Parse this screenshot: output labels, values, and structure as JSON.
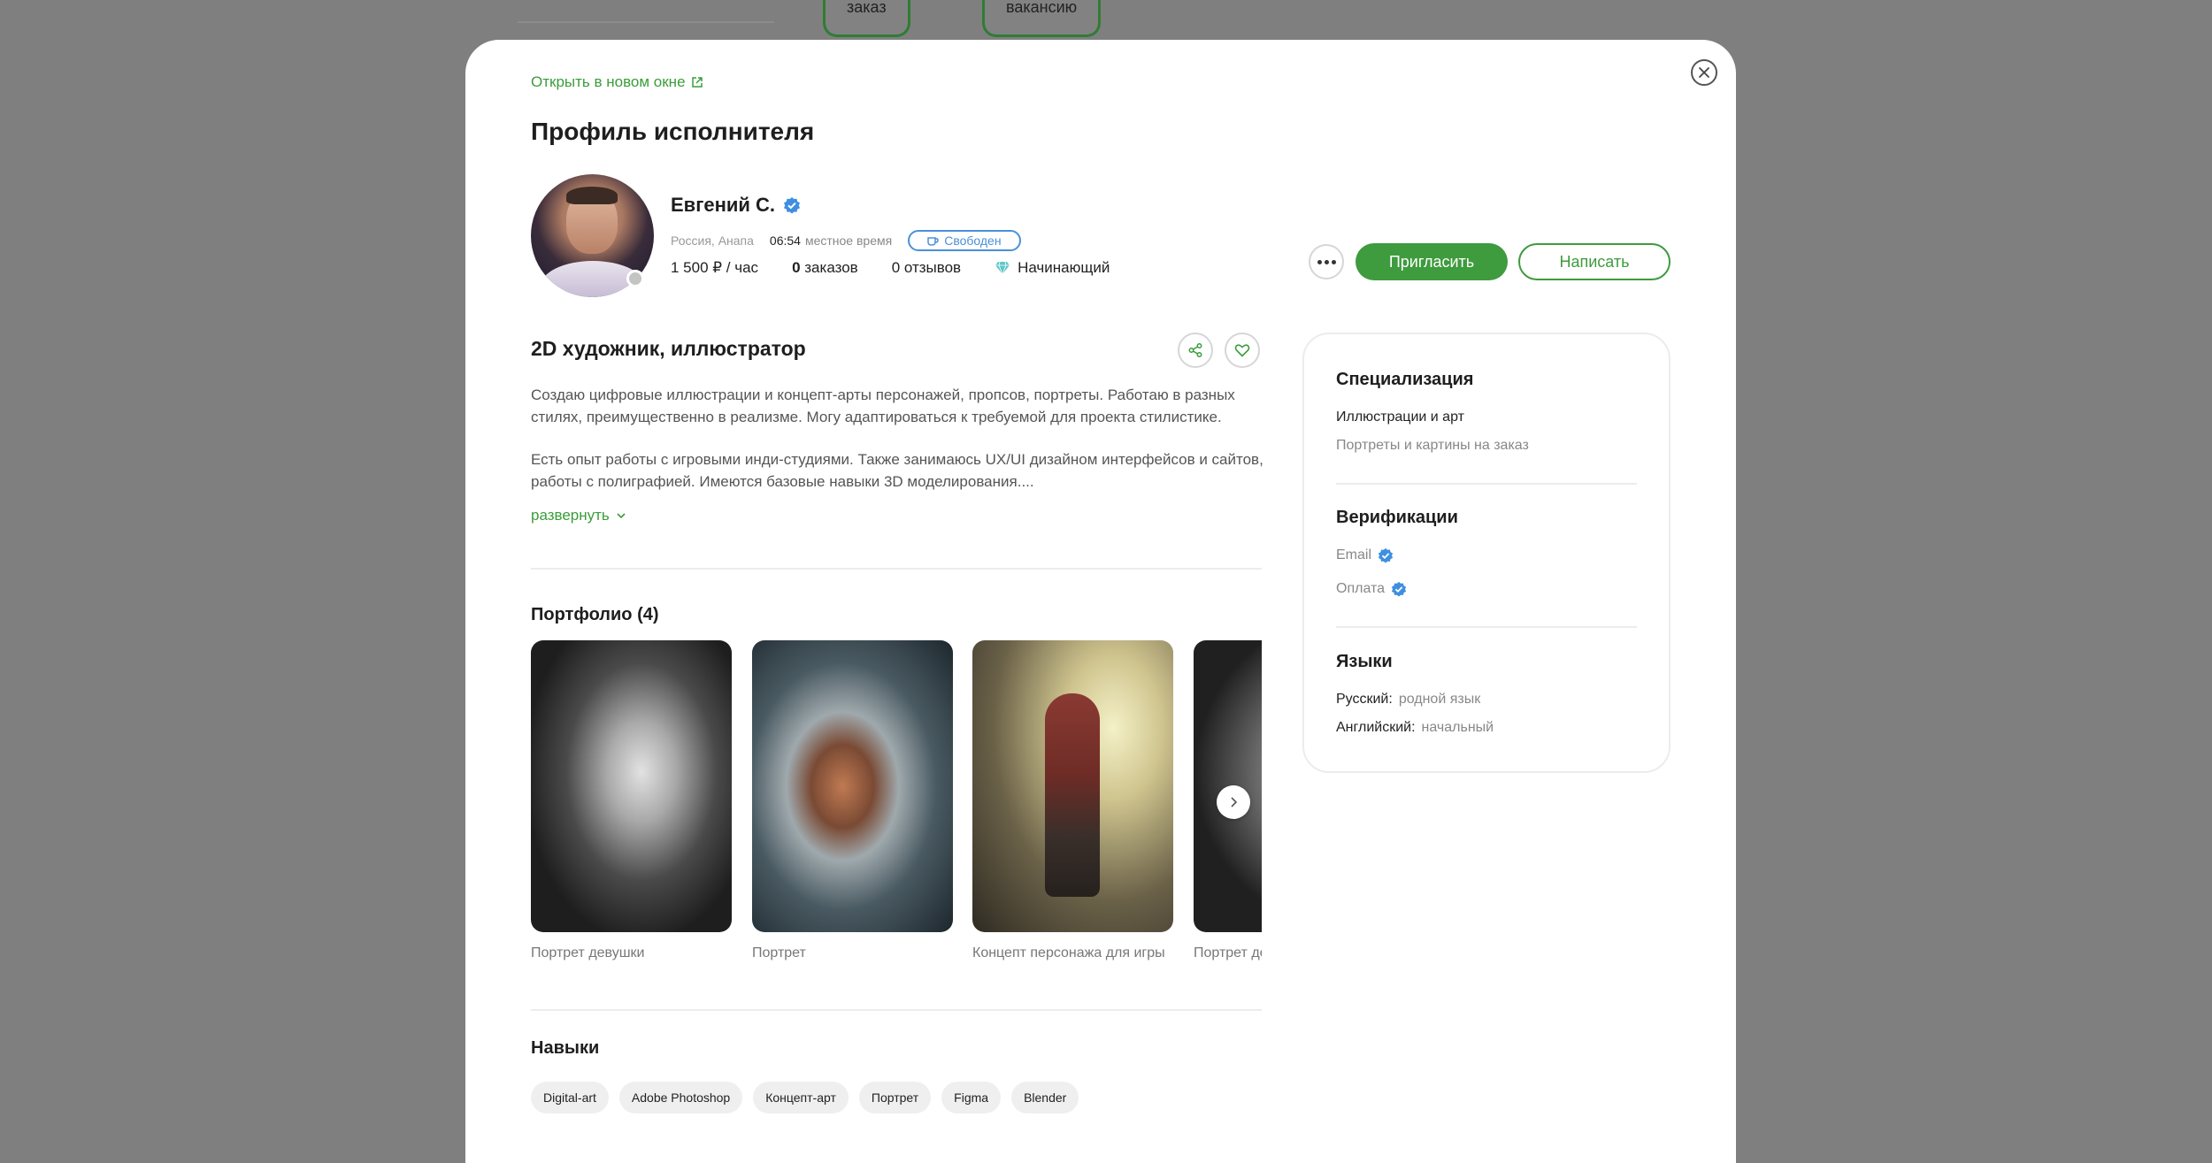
{
  "background": {
    "btn_order": "заказ",
    "btn_vacancy": "вакансию"
  },
  "header": {
    "open_new_window": "Открыть в новом окне",
    "title": "Профиль исполнителя"
  },
  "profile": {
    "name": "Евгений С.",
    "location": "Россия, Анапа",
    "time": "06:54",
    "time_label": "местное время",
    "status": "Свободен",
    "rate": "1 500 ₽ / час",
    "orders_count": "0",
    "orders_label": "заказов",
    "reviews": "0 отзывов",
    "level": "Начинающий"
  },
  "actions": {
    "invite": "Пригласить",
    "write": "Написать"
  },
  "about": {
    "title": "2D художник, иллюстратор",
    "paragraph1_line1": "Создаю цифровые иллюстрации и концепт-арты персонажей, пропсов, портреты. Работаю в разных",
    "paragraph1_line2": "стилях, преимущественно в реализме. Могу адаптироваться к требуемой для проекта стилистике.",
    "paragraph2_line1": "Есть опыт работы с игровыми инди-студиями. Также занимаюсь UX/UI дизайном интерфейсов и сайтов,",
    "paragraph2_line2": "работы с полиграфией. Имеются базовые навыки 3D моделирования....",
    "expand": "развернуть"
  },
  "portfolio": {
    "title": "Портфолио (4)",
    "items": [
      {
        "caption": "Портрет девушки"
      },
      {
        "caption": "Портрет"
      },
      {
        "caption": "Концепт персонажа для игры"
      },
      {
        "caption": "Портрет де"
      }
    ]
  },
  "skills": {
    "title": "Навыки",
    "items": [
      "Digital-art",
      "Adobe Photoshop",
      "Концепт-арт",
      "Портрет",
      "Figma",
      "Blender"
    ]
  },
  "sidebar": {
    "specialization_title": "Специализация",
    "specialization_main": "Иллюстрации и арт",
    "specialization_sub": "Портреты и картины на заказ",
    "verification_title": "Верификации",
    "verification_email": "Email",
    "verification_payment": "Оплата",
    "languages_title": "Языки",
    "lang1_name": "Русский:",
    "lang1_level": "родной язык",
    "lang2_name": "Английский:",
    "lang2_level": "начальный"
  },
  "colors": {
    "accent_green": "#3e9b3e",
    "verified_blue": "#4a90d9"
  }
}
